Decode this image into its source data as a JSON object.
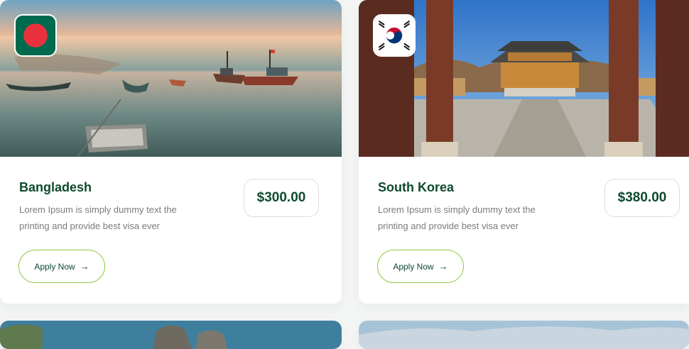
{
  "cards": [
    {
      "country": "Bangladesh",
      "description": "Lorem Ipsum is simply dummy text the printing and provide best visa ever",
      "price": "$300.00",
      "cta": "Apply Now",
      "flag_icon": "bangladesh-flag-icon",
      "photo": "fishing-boats-shore"
    },
    {
      "country": "South Korea",
      "description": "Lorem Ipsum is simply dummy text the printing and provide best visa ever",
      "price": "$380.00",
      "cta": "Apply Now",
      "flag_icon": "south-korea-flag-icon",
      "photo": "korean-palace-gate"
    }
  ],
  "colors": {
    "heading": "#0e4a2f",
    "body_text": "#7b7b7b",
    "button_border": "#8dc63f",
    "card_bg": "#ffffff",
    "page_bg": "#f4f6f5"
  }
}
